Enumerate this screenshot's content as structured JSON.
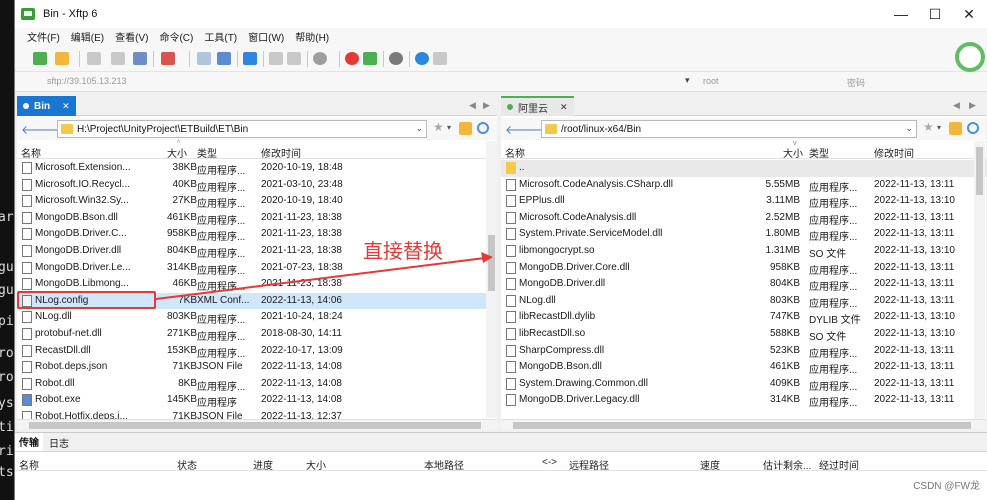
{
  "terminal": {
    "chars": [
      "ar",
      "gu",
      "gu",
      "pi",
      "ro",
      "ro",
      "ys",
      "ti",
      "ri",
      "ts"
    ]
  },
  "window": {
    "title": "Bin - Xftp 6",
    "minimize": "—",
    "maximize": "☐",
    "close": "✕"
  },
  "menu": [
    "文件(F)",
    "编辑(E)",
    "查看(V)",
    "命令(C)",
    "工具(T)",
    "窗口(W)",
    "帮助(H)"
  ],
  "address": {
    "host": "sftp://39.105.13.213",
    "user_placeholder": "root",
    "pass_placeholder": "密码"
  },
  "left": {
    "tab_label": "Bin",
    "path": "H:\\Project\\UnityProject\\ETBuild\\ET\\Bin",
    "columns": {
      "name": "名称",
      "size": "大小",
      "type": "类型",
      "modified": "修改时间"
    },
    "files": [
      {
        "name": "Microsoft.Extension...",
        "size": "38KB",
        "type": "应用程序...",
        "modified": "2020-10-19, 18:48"
      },
      {
        "name": "Microsoft.IO.Recycl...",
        "size": "40KB",
        "type": "应用程序...",
        "modified": "2021-03-10, 23:48"
      },
      {
        "name": "Microsoft.Win32.Sy...",
        "size": "27KB",
        "type": "应用程序...",
        "modified": "2020-10-19, 18:40"
      },
      {
        "name": "MongoDB.Bson.dll",
        "size": "461KB",
        "type": "应用程序...",
        "modified": "2021-11-23, 18:38"
      },
      {
        "name": "MongoDB.Driver.C...",
        "size": "958KB",
        "type": "应用程序...",
        "modified": "2021-11-23, 18:38"
      },
      {
        "name": "MongoDB.Driver.dll",
        "size": "804KB",
        "type": "应用程序...",
        "modified": "2021-11-23, 18:38"
      },
      {
        "name": "MongoDB.Driver.Le...",
        "size": "314KB",
        "type": "应用程序...",
        "modified": "2021-07-23, 18:38"
      },
      {
        "name": "MongoDB.Libmong...",
        "size": "46KB",
        "type": "应用程序...",
        "modified": "2021-11-23, 18:38"
      },
      {
        "name": "NLog.config",
        "size": "7KB",
        "type": "XML Conf...",
        "modified": "2022-11-13, 14:06"
      },
      {
        "name": "NLog.dll",
        "size": "803KB",
        "type": "应用程序...",
        "modified": "2021-10-24, 18:24"
      },
      {
        "name": "protobuf-net.dll",
        "size": "271KB",
        "type": "应用程序...",
        "modified": "2018-08-30, 14:11"
      },
      {
        "name": "RecastDll.dll",
        "size": "153KB",
        "type": "应用程序...",
        "modified": "2022-10-17, 13:09"
      },
      {
        "name": "Robot.deps.json",
        "size": "71KB",
        "type": "JSON File",
        "modified": "2022-11-13, 14:08"
      },
      {
        "name": "Robot.dll",
        "size": "8KB",
        "type": "应用程序...",
        "modified": "2022-11-13, 14:08"
      },
      {
        "name": "Robot.exe",
        "size": "145KB",
        "type": "应用程序",
        "modified": "2022-11-13, 14:08"
      },
      {
        "name": "Robot.Hotfix.deps.j...",
        "size": "71KB",
        "type": "JSON File",
        "modified": "2022-11-13, 12:37"
      }
    ]
  },
  "right": {
    "tab_label": "阿里云",
    "path": "/root/linux-x64/Bin",
    "columns": {
      "name": "名称",
      "size": "大小",
      "type": "类型",
      "modified": "修改时间"
    },
    "updir": "..",
    "files": [
      {
        "name": "Microsoft.CodeAnalysis.CSharp.dll",
        "size": "5.55MB",
        "type": "应用程序...",
        "modified": "2022-11-13, 13:11"
      },
      {
        "name": "EPPlus.dll",
        "size": "3.11MB",
        "type": "应用程序...",
        "modified": "2022-11-13, 13:10"
      },
      {
        "name": "Microsoft.CodeAnalysis.dll",
        "size": "2.52MB",
        "type": "应用程序...",
        "modified": "2022-11-13, 13:11"
      },
      {
        "name": "System.Private.ServiceModel.dll",
        "size": "1.80MB",
        "type": "应用程序...",
        "modified": "2022-11-13, 13:11"
      },
      {
        "name": "libmongocrypt.so",
        "size": "1.31MB",
        "type": "SO 文件",
        "modified": "2022-11-13, 13:10"
      },
      {
        "name": "MongoDB.Driver.Core.dll",
        "size": "958KB",
        "type": "应用程序...",
        "modified": "2022-11-13, 13:11"
      },
      {
        "name": "MongoDB.Driver.dll",
        "size": "804KB",
        "type": "应用程序...",
        "modified": "2022-11-13, 13:11"
      },
      {
        "name": "NLog.dll",
        "size": "803KB",
        "type": "应用程序...",
        "modified": "2022-11-13, 13:11"
      },
      {
        "name": "libRecastDll.dylib",
        "size": "747KB",
        "type": "DYLIB 文件",
        "modified": "2022-11-13, 13:10"
      },
      {
        "name": "libRecastDll.so",
        "size": "588KB",
        "type": "SO 文件",
        "modified": "2022-11-13, 13:10"
      },
      {
        "name": "SharpCompress.dll",
        "size": "523KB",
        "type": "应用程序...",
        "modified": "2022-11-13, 13:11"
      },
      {
        "name": "MongoDB.Bson.dll",
        "size": "461KB",
        "type": "应用程序...",
        "modified": "2022-11-13, 13:11"
      },
      {
        "name": "System.Drawing.Common.dll",
        "size": "409KB",
        "type": "应用程序...",
        "modified": "2022-11-13, 13:11"
      },
      {
        "name": "MongoDB.Driver.Legacy.dll",
        "size": "314KB",
        "type": "应用程序...",
        "modified": "2022-11-13, 13:11"
      }
    ]
  },
  "annotation": {
    "text": "直接替换",
    "color": "#e53935"
  },
  "transfer": {
    "tabs": [
      "传输",
      "日志"
    ],
    "columns": [
      "名称",
      "状态",
      "进度",
      "大小",
      "本地路径",
      "<->",
      "远程路径",
      "速度",
      "估计剩余...",
      "经过时间"
    ]
  },
  "watermark": "CSDN @FW龙",
  "colors": {
    "accent": "#1976d2",
    "selection": "#cfe6fb",
    "annotation": "#e53935",
    "connected": "#5fbf5f"
  }
}
